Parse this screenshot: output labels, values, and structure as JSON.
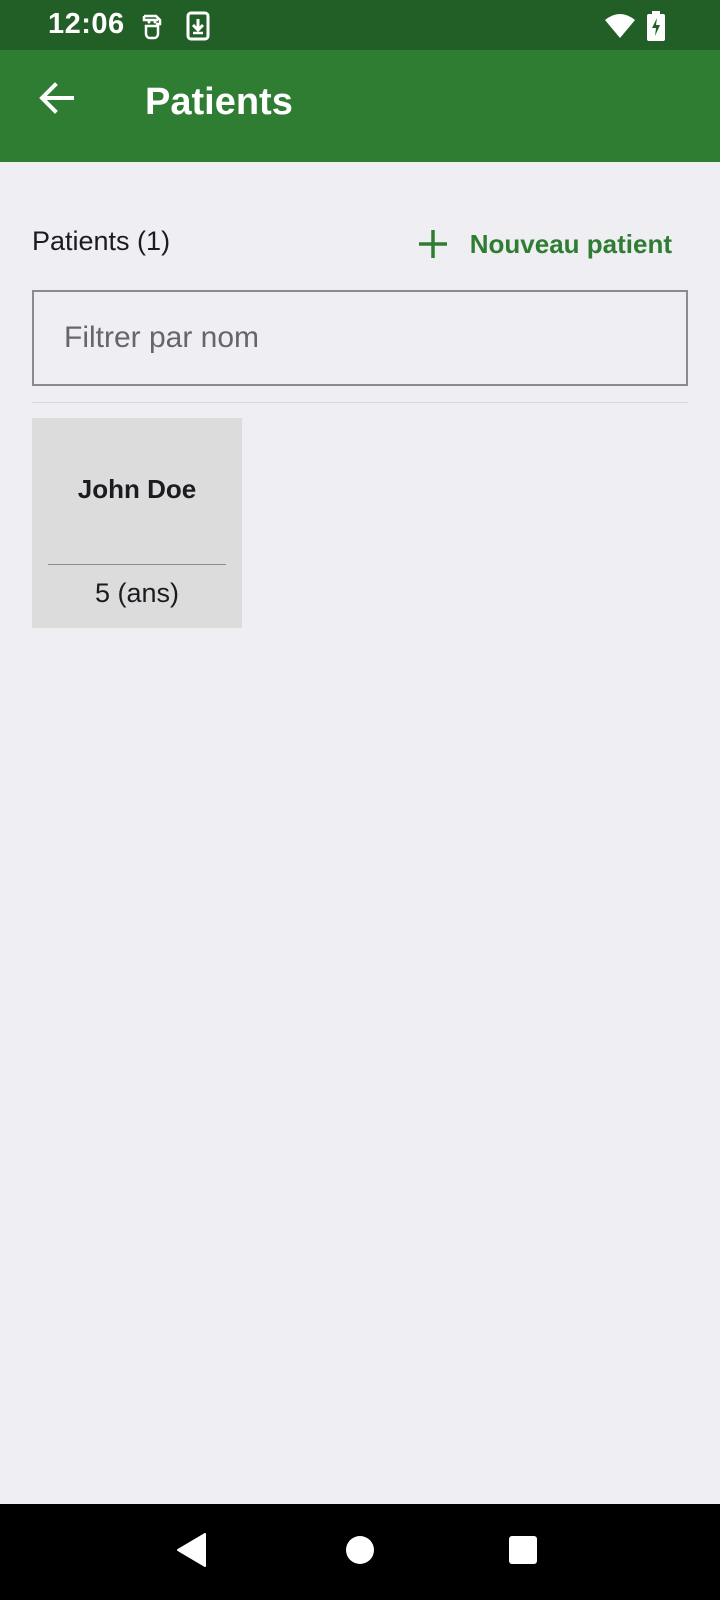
{
  "status_bar": {
    "time": "12:06",
    "icons": [
      "sim-card-icon",
      "download-icon",
      "wifi-icon",
      "battery-charging-icon"
    ]
  },
  "app_bar": {
    "title": "Patients",
    "back_icon": "arrow-back-icon"
  },
  "patients_section": {
    "title": "Patients (1)",
    "new_button_label": "Nouveau patient",
    "new_button_icon": "plus-icon",
    "filter": {
      "placeholder": "Filtrer par nom",
      "value": ""
    },
    "patients": [
      {
        "name": "John Doe",
        "age": "5 (ans)"
      }
    ]
  },
  "nav_bar": {
    "icons": [
      "back-triangle-icon",
      "home-circle-icon",
      "recents-square-icon"
    ]
  },
  "colors": {
    "status_bar": "#225f27",
    "app_bar": "#2f7d32",
    "accent": "#2f7d32",
    "background": "#efeef3",
    "card": "#dcdcdd"
  }
}
